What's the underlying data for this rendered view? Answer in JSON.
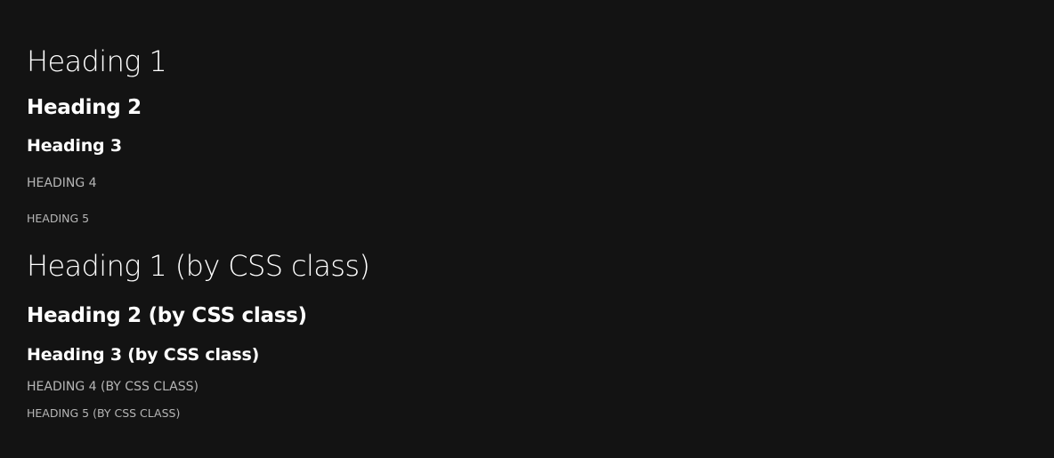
{
  "headings": [
    {
      "level": "h1",
      "text": "Heading 1"
    },
    {
      "level": "h2",
      "text": "Heading 2"
    },
    {
      "level": "h3",
      "text": "Heading 3"
    },
    {
      "level": "h4",
      "text": "HEADING 4"
    },
    {
      "level": "h5",
      "text": "HEADING 5"
    }
  ],
  "class_headings": [
    {
      "level": "h1",
      "text": "Heading 1 (by CSS class)"
    },
    {
      "level": "h2",
      "text": "Heading 2 (by CSS class)"
    },
    {
      "level": "h3",
      "text": "Heading 3 (by CSS class)"
    },
    {
      "level": "h4",
      "text": "HEADING 4 (BY CSS CLASS)"
    },
    {
      "level": "h5",
      "text": "HEADING 5 (BY CSS CLASS)"
    }
  ],
  "theme": {
    "background": "#131313",
    "heading_color": "#ffffff",
    "muted_heading_color": "#b6b6b6"
  }
}
